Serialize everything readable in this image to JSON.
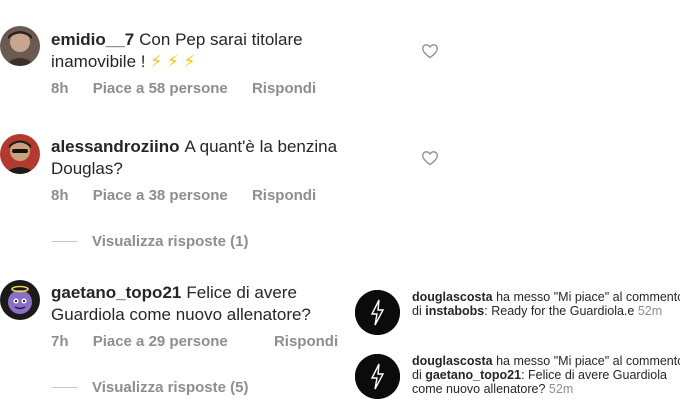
{
  "comments": [
    {
      "username": "emidio__7",
      "text": "Con Pep sarai titolare inamovibile !",
      "emoji": "⚡ ⚡ ⚡",
      "time": "8h",
      "likes": "Piace a 58 persone",
      "reply": "Rispondi"
    },
    {
      "username": "alessandroziino",
      "text": "A quant'è la benzina Douglas?",
      "time": "8h",
      "likes": "Piace a 38 persone",
      "reply": "Rispondi",
      "view_replies": "Visualizza risposte (1)"
    },
    {
      "username": "gaetano_topo21",
      "text": "Felice di avere Guardiola come nuovo allenatore?",
      "time": "7h",
      "likes": "Piace a 29 persone",
      "reply": "Rispondi",
      "view_replies": "Visualizza risposte (5)"
    }
  ],
  "notifications": [
    {
      "username": "douglascosta",
      "action": "ha messo \"Mi piace\" al commento di",
      "target": "instabobs",
      "quote": ": Ready for the Guardiola.e",
      "time": "52m"
    },
    {
      "username": "douglascosta",
      "action": "ha messo \"Mi piace\" al commento di",
      "target": "gaetano_topo21",
      "quote": ": Felice di avere Guardiola come nuovo allenatore?",
      "time": "52m"
    }
  ],
  "colors": {
    "text": "#262626",
    "secondary": "#8e8e8e",
    "emoji": "#f5c518"
  }
}
